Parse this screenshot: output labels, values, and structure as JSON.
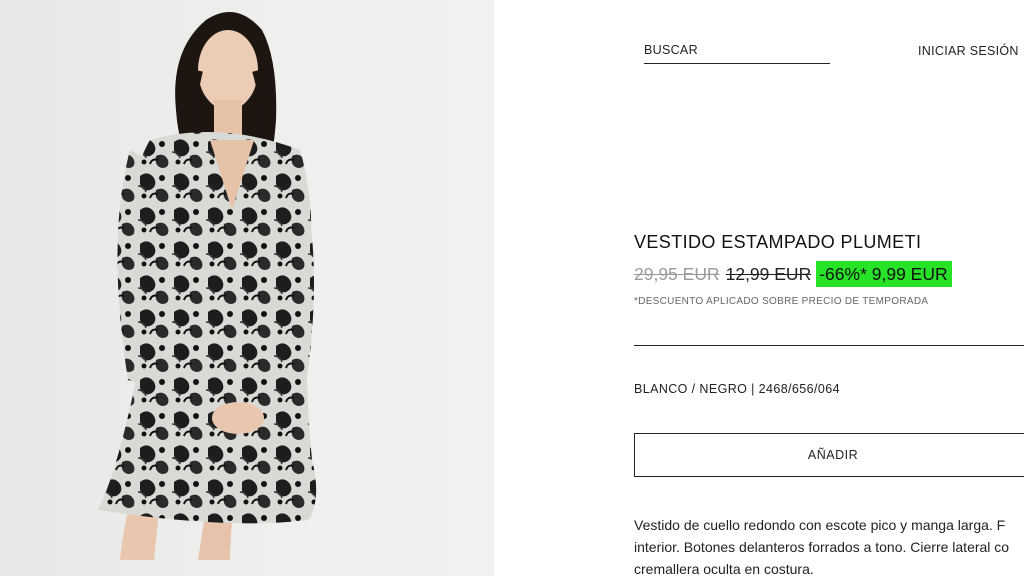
{
  "header": {
    "search_label": "BUSCAR",
    "login_label": "INICIAR SESIÓN"
  },
  "product": {
    "title": "VESTIDO ESTAMPADO PLUMETI",
    "original_price": "29,95 EUR",
    "previous_price": "12,99 EUR",
    "discount_price": "-66%* 9,99 EUR",
    "discount_note": "*DESCUENTO APLICADO SOBRE PRECIO DE TEMPORADA",
    "color_and_ref": "BLANCO / NEGRO | 2468/656/064",
    "add_button_label": "AÑADIR",
    "description_lines": [
      "Vestido de cuello redondo con escote pico y manga larga. F",
      "interior. Botones delanteros forrados a tono. Cierre lateral co",
      "cremallera oculta en costura."
    ]
  },
  "colors": {
    "discount_highlight": "#27e327",
    "photo_background": "#ececea"
  }
}
